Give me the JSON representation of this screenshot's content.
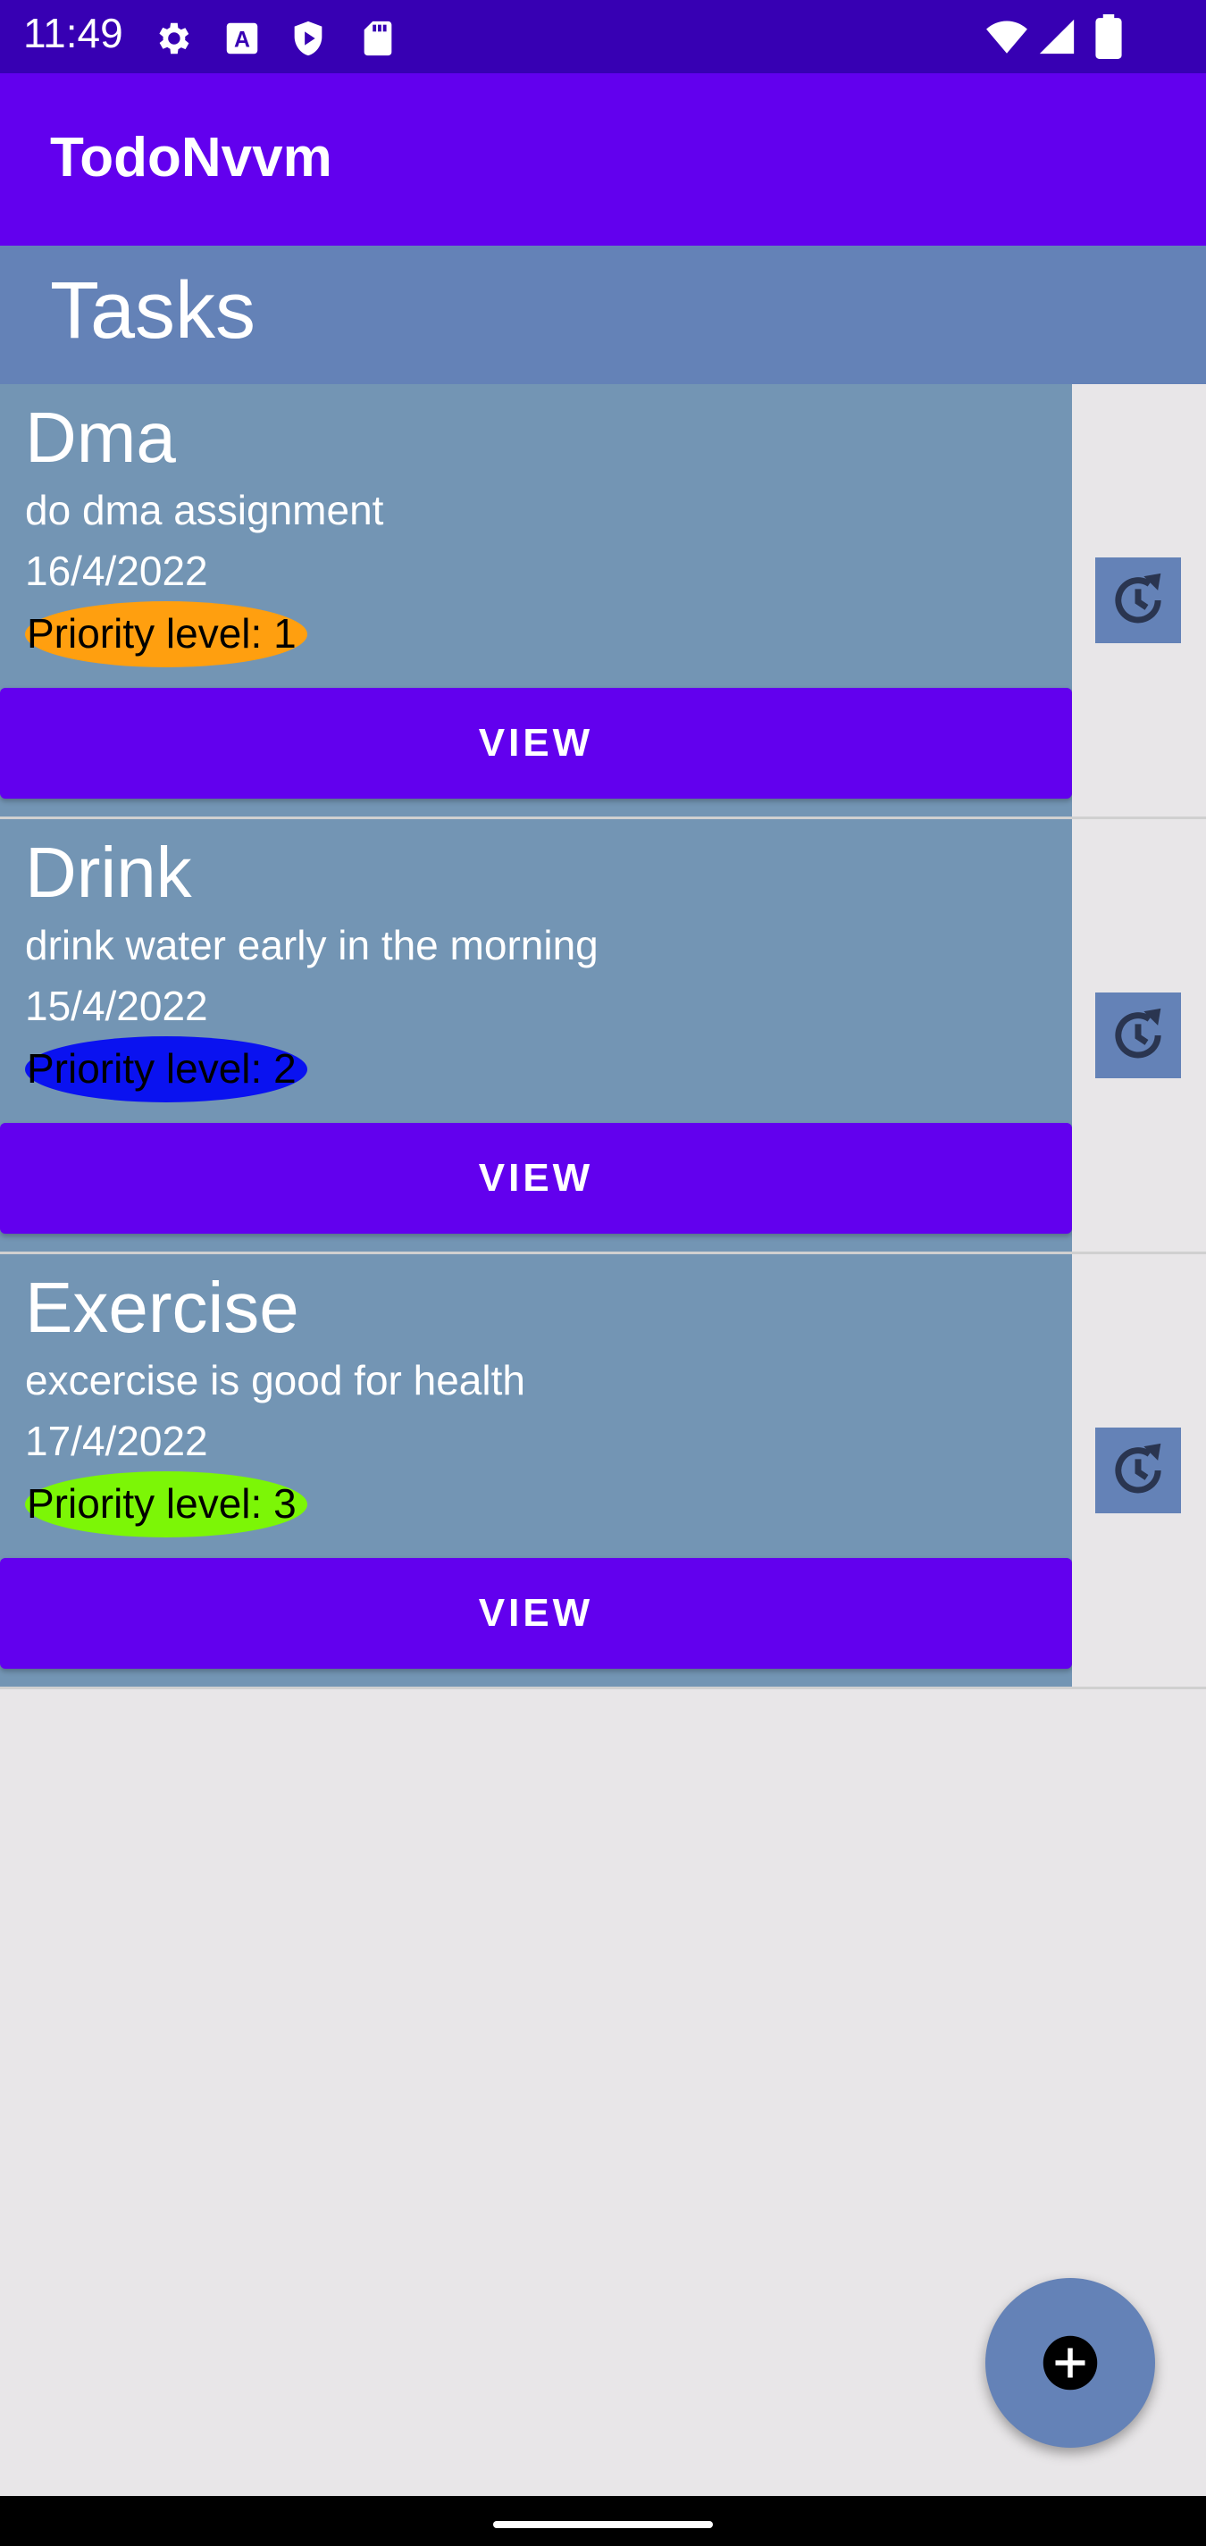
{
  "status_bar": {
    "time": "11:49",
    "icons": [
      "gear-icon",
      "font-a-icon",
      "play-protect-icon",
      "sd-card-icon",
      "wifi-icon",
      "signal-icon",
      "battery-icon"
    ]
  },
  "app_bar": {
    "title": "TodoNvvm"
  },
  "section": {
    "title": "Tasks"
  },
  "tasks": [
    {
      "title": "Dma",
      "description": "do dma assignment",
      "date": "16/4/2022",
      "priority": "Priority level: 1",
      "priority_color": "#ff9f0f",
      "view_label": "VIEW"
    },
    {
      "title": "Drink",
      "description": "drink water early in the morning",
      "date": "15/4/2022",
      "priority": "Priority level: 2",
      "priority_color": "#0a12f0",
      "view_label": "VIEW"
    },
    {
      "title": "Exercise",
      "description": "excercise is good for health",
      "date": "17/4/2022",
      "priority": "Priority level: 3",
      "priority_color": "#7cf606",
      "view_label": "VIEW"
    }
  ],
  "colors": {
    "status_bar": "#3700b3",
    "app_bar": "#6200ee",
    "section_header": "#6482b7",
    "card": "#7395b4",
    "button": "#6200ee",
    "background": "#e8e6e8"
  },
  "fab": {
    "icon": "add-circle-icon"
  }
}
